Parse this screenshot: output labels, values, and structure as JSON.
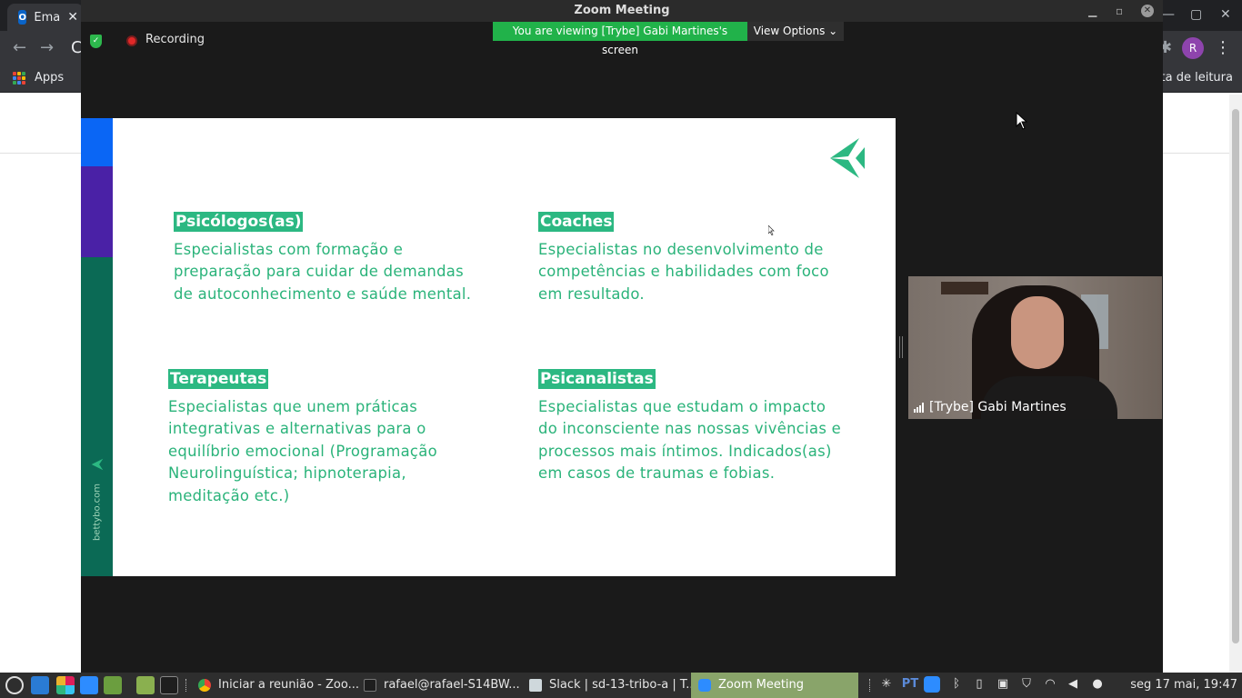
{
  "chrome": {
    "tab_title": "Ema",
    "tab_close": "✕",
    "tab_favicon": "O",
    "bookmarks": {
      "apps_label": "Apps",
      "reading_list_label": "sta de leitura"
    },
    "profile_initial": "R",
    "nav_back": "←",
    "nav_forward": "→",
    "nav_reload": "C",
    "window_controls": {
      "minimize": "—",
      "maximize": "▢",
      "close": "✕"
    }
  },
  "zoom": {
    "window_title": "Zoom Meeting",
    "controls": {
      "minimize": "▁",
      "restore": "▫",
      "close": "✕"
    },
    "recording_label": "Recording",
    "viewing_banner": "You are viewing [Trybe] Gabi Martines's screen",
    "view_options_label": "View Options",
    "view_options_chevron": "⌄",
    "participant_name": "[Trybe] Gabi Martines"
  },
  "slide": {
    "side_site": "bettybo.com",
    "cards": [
      {
        "title": "Psicólogos(as)",
        "lines": [
          "Especialistas com formação e",
          "preparação para cuidar de demandas",
          "de autoconhecimento e saúde mental."
        ]
      },
      {
        "title": "Coaches",
        "lines": [
          "Especialistas no desenvolvimento de",
          "competências e habilidades com foco",
          "em resultado."
        ]
      },
      {
        "title": "Terapeutas",
        "lines": [
          "Especialistas que unem práticas",
          "integrativas e alternativas para o",
          "equilíbrio emocional (Programação",
          "Neurolinguística; hipnoterapia,",
          "meditação etc.)"
        ]
      },
      {
        "title": "Psicanalistas",
        "lines": [
          "Especialistas que estudam o impacto",
          "do inconsciente nas nossas vivências e",
          "processos mais íntimos. Indicados(as)",
          "em casos de traumas e fobias."
        ]
      }
    ]
  },
  "taskbar": {
    "tasks": [
      {
        "label": "Iniciar a reunião - Zoo...",
        "icon": "chrome-icon"
      },
      {
        "label": "rafael@rafael-S14BW...",
        "icon": "terminal-icon"
      },
      {
        "label": "Slack | sd-13-tribo-a | T...",
        "icon": "slack-window-icon"
      },
      {
        "label": "Zoom Meeting",
        "icon": "zoom-icon"
      }
    ],
    "keyboard_layout": "PT",
    "clock": "seg 17 mai, 19:47"
  },
  "colors": {
    "slide_green": "#2cb882",
    "banner_green": "#21b24a",
    "bar_blue": "#0a66f5",
    "bar_purple": "#4a21a6",
    "bar_dark_green": "#0b6a55",
    "taskbar_active": "#89a46a"
  }
}
